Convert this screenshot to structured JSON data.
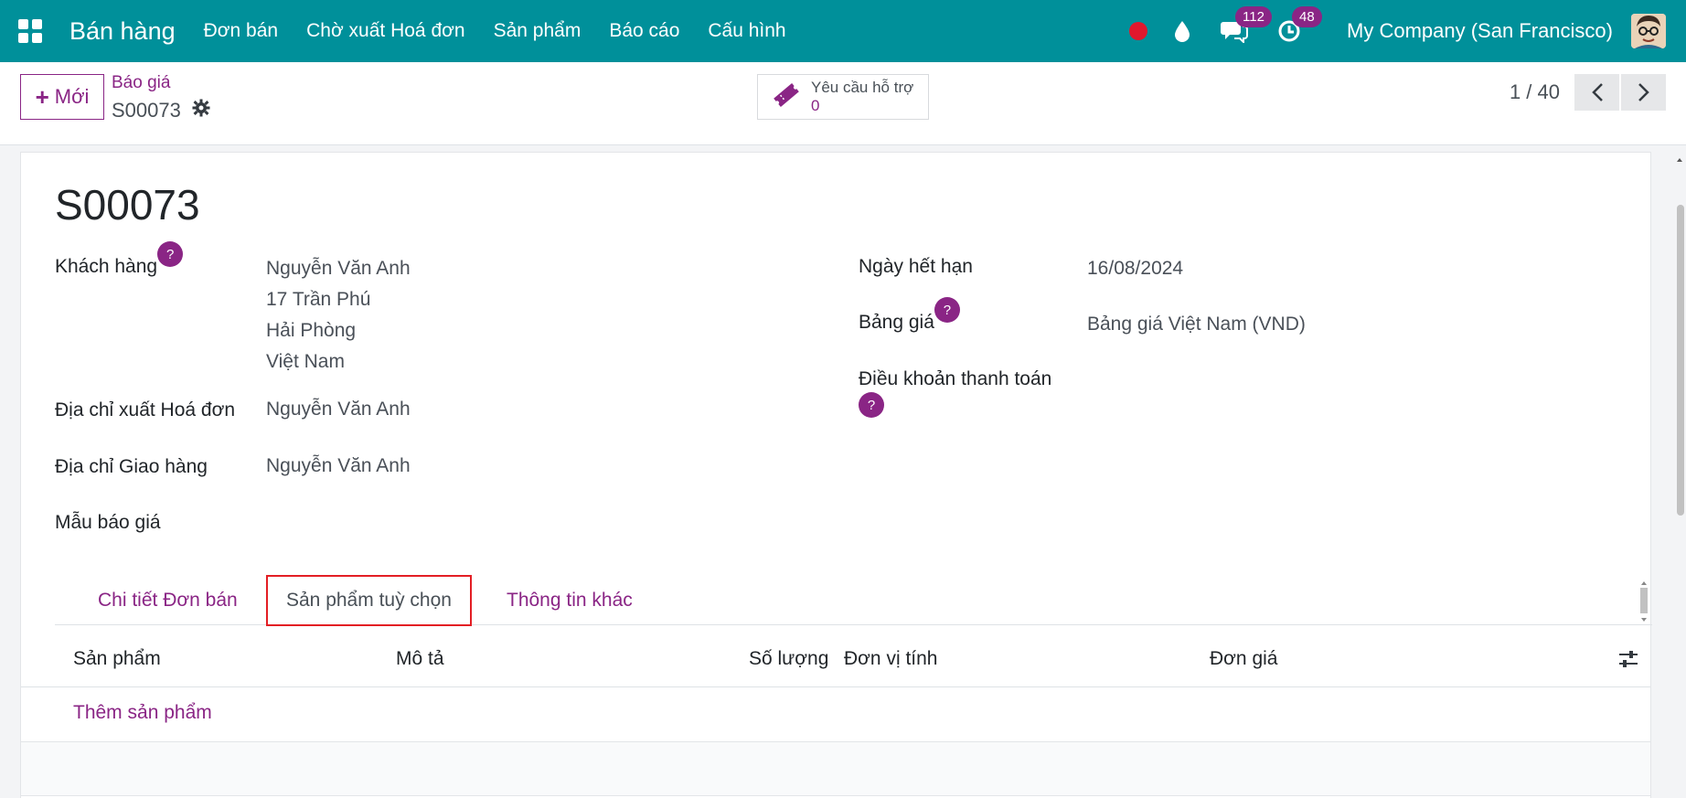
{
  "navbar": {
    "app_name": "Bán hàng",
    "menu": [
      "Đơn bán",
      "Chờ xuất Hoá đơn",
      "Sản phẩm",
      "Báo cáo",
      "Cấu hình"
    ],
    "messages_count": "112",
    "activities_count": "48",
    "company": "My Company (San Francisco)",
    "colors": {
      "bar": "#00909a",
      "badge": "#8a2585",
      "record": "#e0182d"
    }
  },
  "control": {
    "new_label": "Mới",
    "breadcrumb_parent": "Báo giá",
    "breadcrumb_current": "S00073",
    "support_label": "Yêu cầu hỗ trợ",
    "support_count": "0",
    "pager_value": "1 / 40"
  },
  "form": {
    "name": "S00073",
    "customer_label": "Khách hàng",
    "customer_lines": [
      "Nguyễn Văn Anh",
      "17 Trần Phú",
      "Hải Phòng",
      "Việt Nam"
    ],
    "invoice_address_label": "Địa chỉ xuất Hoá đơn",
    "invoice_address_value": "Nguyễn Văn Anh",
    "delivery_address_label": "Địa chỉ Giao hàng",
    "delivery_address_value": "Nguyễn Văn Anh",
    "quote_template_label": "Mẫu báo giá",
    "expiration_label": "Ngày hết hạn",
    "expiration_value": "16/08/2024",
    "pricelist_label": "Bảng giá",
    "pricelist_value": "Bảng giá Việt Nam (VND)",
    "payment_terms_label": "Điều khoản thanh toán",
    "help_mark": "?"
  },
  "tabs": [
    "Chi tiết Đơn bán",
    "Sản phẩm tuỳ chọn",
    "Thông tin khác"
  ],
  "active_tab": 1,
  "table": {
    "columns": [
      "Sản phẩm",
      "Mô tả",
      "Số lượng",
      "Đơn vị tính",
      "Đơn giá"
    ],
    "add_line": "Thêm sản phẩm"
  }
}
